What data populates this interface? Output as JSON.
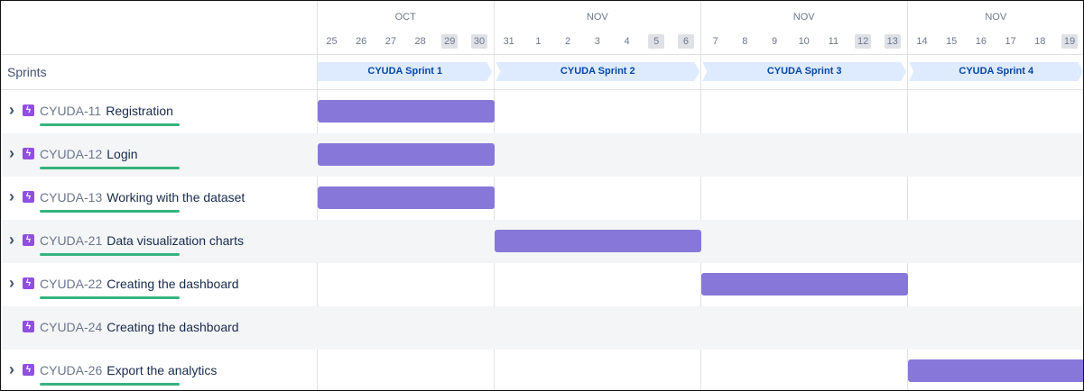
{
  "timeline": {
    "months": [
      {
        "label": "OCT"
      },
      {
        "label": "NOV"
      },
      {
        "label": "NOV"
      },
      {
        "label": "NOV"
      }
    ],
    "days": [
      {
        "label": "25",
        "weekend": false
      },
      {
        "label": "26",
        "weekend": false
      },
      {
        "label": "27",
        "weekend": false
      },
      {
        "label": "28",
        "weekend": false
      },
      {
        "label": "29",
        "weekend": true
      },
      {
        "label": "30",
        "weekend": true
      },
      {
        "label": "31",
        "weekend": false
      },
      {
        "label": "1",
        "weekend": false
      },
      {
        "label": "2",
        "weekend": false
      },
      {
        "label": "3",
        "weekend": false
      },
      {
        "label": "4",
        "weekend": false
      },
      {
        "label": "5",
        "weekend": true
      },
      {
        "label": "6",
        "weekend": true
      },
      {
        "label": "7",
        "weekend": false
      },
      {
        "label": "8",
        "weekend": false
      },
      {
        "label": "9",
        "weekend": false
      },
      {
        "label": "10",
        "weekend": false
      },
      {
        "label": "11",
        "weekend": false
      },
      {
        "label": "12",
        "weekend": true
      },
      {
        "label": "13",
        "weekend": true
      },
      {
        "label": "14",
        "weekend": false
      },
      {
        "label": "15",
        "weekend": false
      },
      {
        "label": "16",
        "weekend": false
      },
      {
        "label": "17",
        "weekend": false
      },
      {
        "label": "18",
        "weekend": false
      },
      {
        "label": "19",
        "weekend": true
      }
    ]
  },
  "sprints_label": "Sprints",
  "sprints": [
    {
      "name": "CYUDA Sprint 1",
      "start_day": "25",
      "end_day": "30"
    },
    {
      "name": "CYUDA Sprint 2",
      "start_day": "31",
      "end_day": "6"
    },
    {
      "name": "CYUDA Sprint 3",
      "start_day": "7",
      "end_day": "13"
    },
    {
      "name": "CYUDA Sprint 4",
      "start_day": "14",
      "end_day": "19"
    }
  ],
  "issues": [
    {
      "key": "CYUDA-11",
      "summary": "Registration",
      "expandable": true,
      "progress": 1.0,
      "bar": {
        "start": "25",
        "end": "31"
      }
    },
    {
      "key": "CYUDA-12",
      "summary": "Login",
      "expandable": true,
      "progress": 1.0,
      "bar": {
        "start": "25",
        "end": "31"
      }
    },
    {
      "key": "CYUDA-13",
      "summary": "Working with the dataset",
      "expandable": true,
      "progress": 1.0,
      "bar": {
        "start": "25",
        "end": "31"
      }
    },
    {
      "key": "CYUDA-21",
      "summary": "Data visualization charts",
      "expandable": true,
      "progress": 1.0,
      "bar": {
        "start": "31",
        "end": "7"
      }
    },
    {
      "key": "CYUDA-22",
      "summary": "Creating the dashboard",
      "expandable": true,
      "progress": 1.0,
      "bar": {
        "start": "7",
        "end": "14"
      }
    },
    {
      "key": "CYUDA-24",
      "summary": "Creating the dashboard",
      "expandable": false,
      "progress": null,
      "bar": null
    },
    {
      "key": "CYUDA-26",
      "summary": "Export the analytics",
      "expandable": true,
      "progress": 1.0,
      "bar": {
        "start": "14",
        "end": "19"
      }
    }
  ],
  "colors": {
    "epic_icon": "#904ee2",
    "bar": "#8777d9",
    "progress": "#36b37e",
    "sprint_pill_bg": "#deebff",
    "sprint_pill_text": "#0747a6"
  }
}
